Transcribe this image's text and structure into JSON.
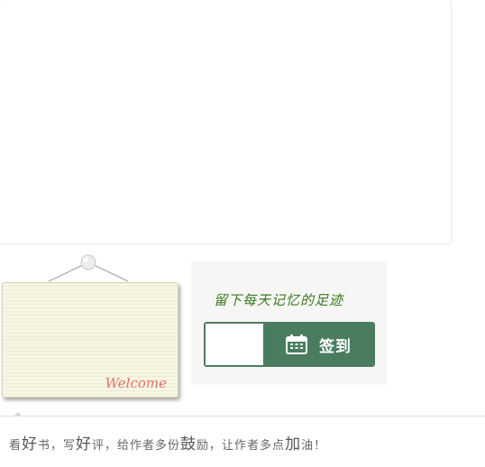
{
  "welcome": {
    "text": "Welcome"
  },
  "signin": {
    "tagline": "留下每天记忆的足迹",
    "button_label": "签到",
    "button_icon": "calendar-icon"
  },
  "footer": {
    "parts": [
      "看",
      "好",
      "书，写",
      "好",
      "评，给作者多份",
      "鼓",
      "励，让作者多点",
      "加",
      "油！"
    ]
  },
  "colors": {
    "accent": "#4a7c5f",
    "tagline": "#3a7a22",
    "welcome": "#e2706a",
    "sign_paper": "#f7f6e4"
  }
}
